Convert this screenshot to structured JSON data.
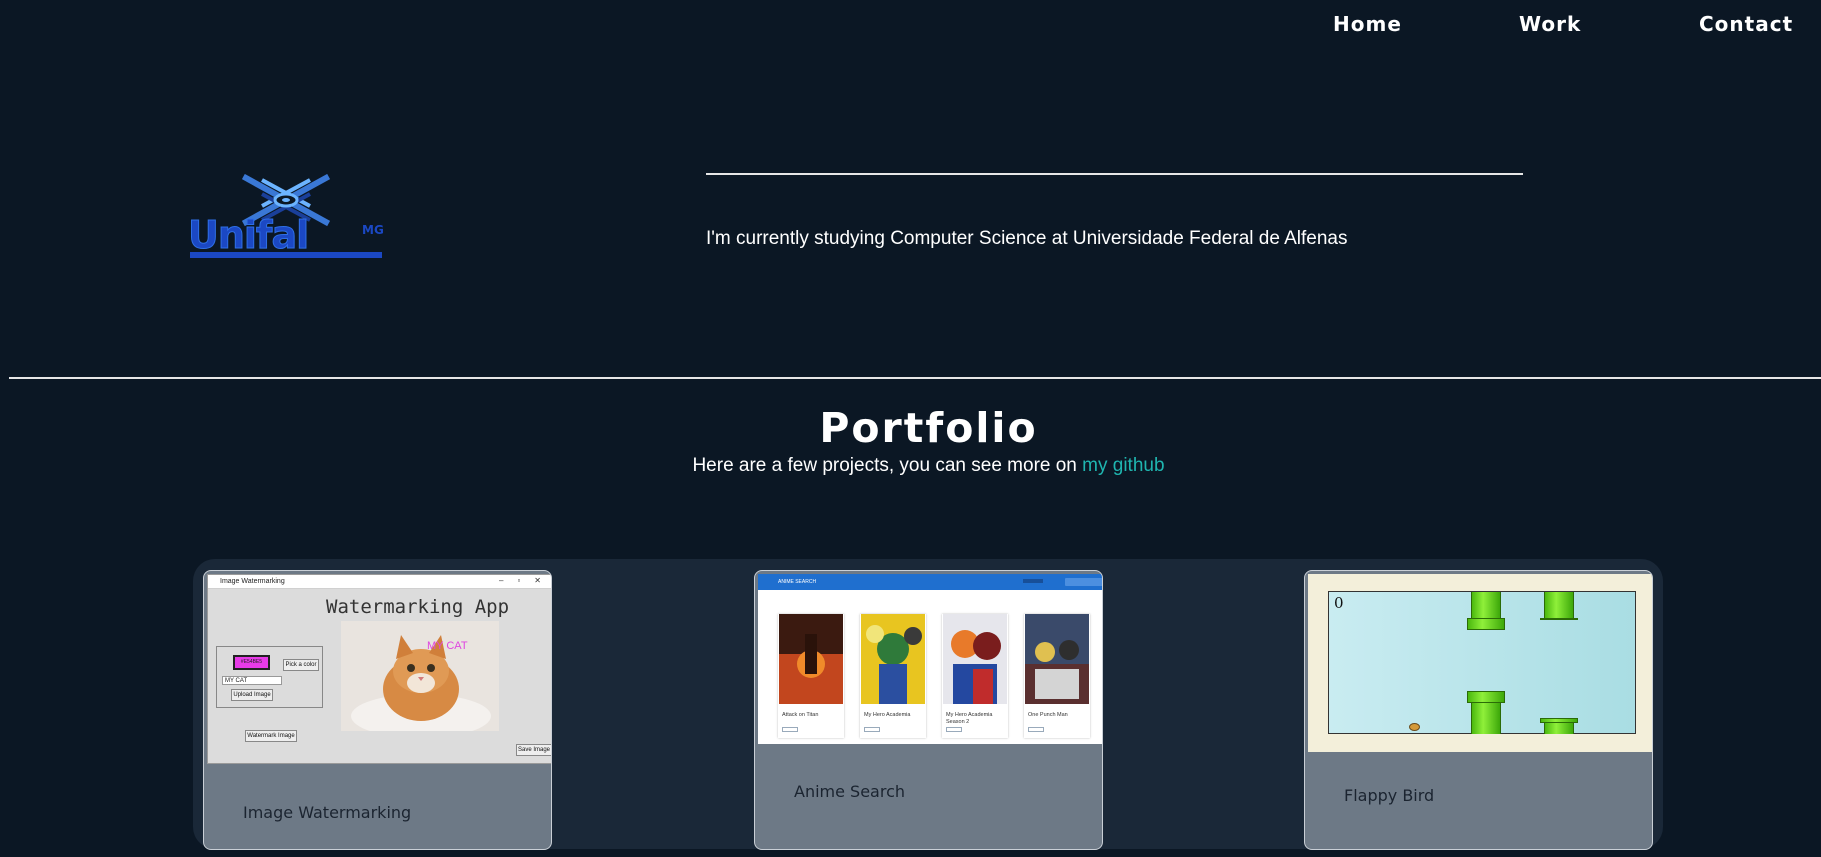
{
  "nav": {
    "items": [
      {
        "label": "Home"
      },
      {
        "label": "Work"
      },
      {
        "label": "Contact"
      }
    ]
  },
  "hero": {
    "logo_alt": "Unifal-MG Universidade Federal de Alfenas",
    "text": "I'm currently studying Computer Science at Universidade Federal de Alfenas"
  },
  "portfolio": {
    "title": "Portfolio",
    "subtitle_prefix": "Here are a few projects, you can see more on ",
    "github_link": "my github",
    "projects": [
      {
        "label": "Image Watermarking",
        "window_title": "Image Watermarking",
        "app_title": "Watermarking App",
        "swatch_hex": "#E54BE5",
        "pick_color": "Pick a color",
        "input_value": "MY CAT",
        "upload": "Upload Image",
        "watermark": "Watermark Image",
        "save": "Save Image",
        "overlay_text": "MY CAT"
      },
      {
        "label": "Anime Search",
        "app_bar": "ANIME SEARCH",
        "titles": [
          "Attack on Titan",
          "My Hero Academia",
          "My Hero Academia Season 2",
          "One Punch Man"
        ]
      },
      {
        "label": "Flappy Bird",
        "score": "0"
      }
    ]
  },
  "colors": {
    "background": "#0b1724",
    "panel": "#1a2838",
    "card": "#6d7986",
    "link": "#1fb6b0"
  }
}
